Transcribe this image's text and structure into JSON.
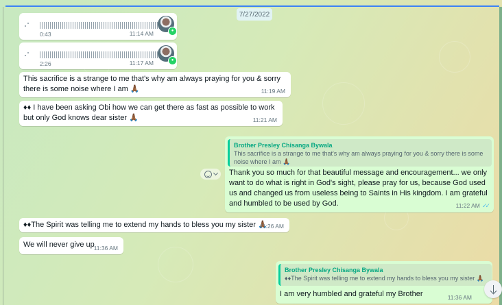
{
  "chat": {
    "date_label": "7/27/2022",
    "voice_notes": [
      {
        "duration": "0:43",
        "time": "11:14 AM"
      },
      {
        "duration": "2:26",
        "time": "11:17 AM"
      }
    ],
    "incoming_1": {
      "text": "This sacrifice is a strange to me that's why am always praying for you & sorry there is some noise where I am 🙏🏾",
      "time": "11:19 AM"
    },
    "incoming_2": {
      "text": "♦♦ I have been asking Obi how we can get there as fast as possible to work but only God knows dear sister 🙏🏾",
      "time": "11:21 AM"
    },
    "outgoing_1": {
      "quote_author": "Brother Presley Chisanga Bywala",
      "quote_text": "This sacrifice is a strange to me that's why am always praying for you & sorry there is some noise where I am 🙏🏾",
      "text": "Thank you so much for that beautiful message and encouragement... we only want to do what is right in God's sight, please pray for us, because God used us and changed us from useless being to Saints in His kingdom. I am grateful and humbled to be used by God.",
      "time": "11:22 AM",
      "ticks": "✓✓"
    },
    "incoming_3": {
      "text": "♦♦The Spirit was telling me to extend my hands to bless you my sister 🙏🏾",
      "time": "11:26 AM"
    },
    "incoming_4": {
      "text": "We will never give up",
      "time": "11:36 AM"
    },
    "outgoing_2": {
      "quote_author": "Brother Presley Chisanga Bywala",
      "quote_text": "♦♦The Spirit was telling me to extend my hands to bless you my sister 🙏🏾",
      "text": "I am very humbled and grateful my Brother",
      "time": "11:36 AM"
    }
  },
  "colors": {
    "incoming_bubble": "#ffffff",
    "outgoing_bubble": "#d9fdd3",
    "quote_accent": "#06cf9c",
    "read_ticks": "#53bdeb"
  },
  "icons": {
    "reaction": "emoji-reaction-icon",
    "scroll_down": "arrow-down-icon",
    "mic_badge": "microphone-icon"
  }
}
